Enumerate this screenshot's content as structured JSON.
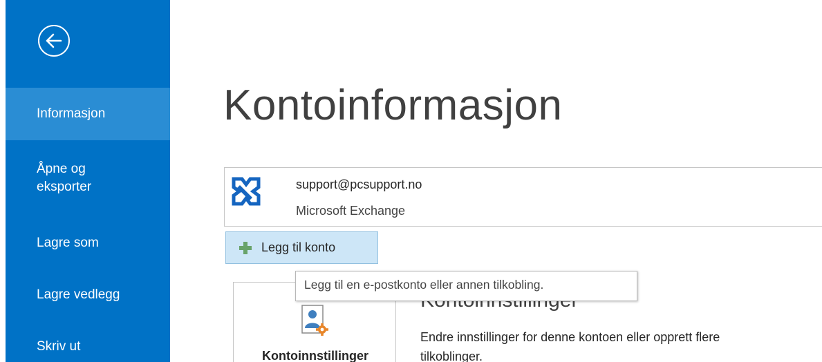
{
  "sidebar": {
    "items": [
      {
        "label": "Informasjon",
        "active": true
      },
      {
        "label": "Åpne og eksporter",
        "line1": "Åpne og",
        "line2": "eksporter"
      },
      {
        "label": "Lagre som"
      },
      {
        "label": "Lagre vedlegg"
      },
      {
        "label": "Skriv ut"
      }
    ],
    "back_icon": "back-arrow-icon",
    "accent_color": "#0072c6",
    "active_color": "#2a8dd4"
  },
  "main": {
    "title": "Kontoinformasjon",
    "account": {
      "email": "support@pcsupport.no",
      "type": "Microsoft Exchange",
      "icon": "exchange-icon"
    },
    "add_account_label": "Legg til konto",
    "tooltip": "Legg til en e-postkonto eller annen tilkobling.",
    "settings_tile_label": "Kontoinnstillinger",
    "section_heading": "Kontoinnstillinger",
    "section_description_line1": "Endre innstillinger for denne kontoen eller opprett flere",
    "section_description_line2": "tilkoblinger."
  }
}
